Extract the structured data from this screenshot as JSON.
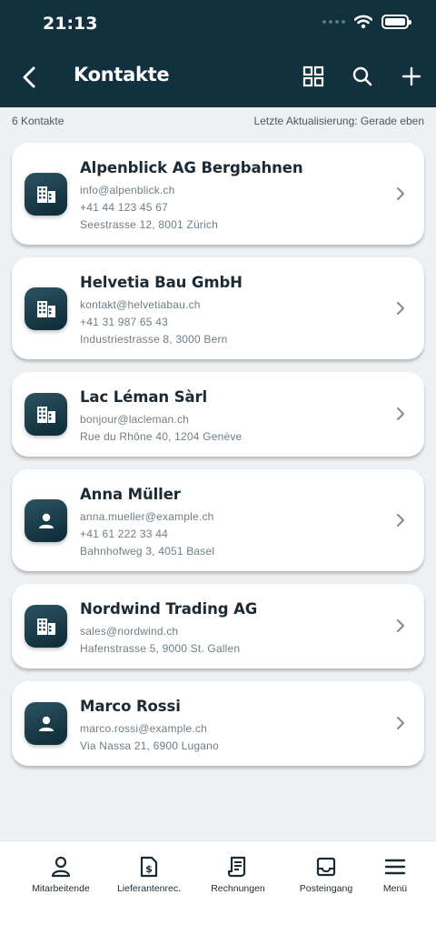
{
  "status_bar": {
    "time": "21:13"
  },
  "nav": {
    "title": "Kontakte",
    "icons": [
      "back-arrow-icon",
      "grid-view-icon",
      "search-icon",
      "plus-icon"
    ]
  },
  "list_meta": {
    "count_text": "6 Kontakte",
    "updated_text": "Letzte Aktualisierung: Gerade eben"
  },
  "contacts": [
    {
      "name": "Alpenblick AG Bergbahnen",
      "email": "info@alpenblick.ch",
      "phone": "+41 44 123 45 67",
      "address": "Seestrasse 12, 8001 Zürich",
      "icon": "building-icon"
    },
    {
      "name": "Helvetia Bau GmbH",
      "email": "kontakt@helvetiabau.ch",
      "phone": "+41 31 987 65 43",
      "address": "Industriestrasse 8, 3000 Bern",
      "icon": "building-icon"
    },
    {
      "name": "Lac Léman Sàrl",
      "email": "bonjour@lacleman.ch",
      "address": "Rue du Rhône 40, 1204 Genève",
      "icon": "building-icon"
    },
    {
      "name": "Anna Müller",
      "email": "anna.mueller@example.ch",
      "phone": "+41 61 222 33 44",
      "address": "Bahnhofweg 3, 4051 Basel",
      "icon": "person-icon"
    },
    {
      "name": "Nordwind Trading AG",
      "email": "sales@nordwind.ch",
      "address": "Hafenstrasse 5, 9000 St. Gallen",
      "icon": "building-icon"
    },
    {
      "name": "Marco Rossi",
      "email": "marco.rossi@example.ch",
      "address": "Via Nassa 21, 6900 Lugano",
      "icon": "person-icon"
    }
  ],
  "bottom_nav": [
    {
      "label": "Mitarbeitende",
      "icon": "person-outline-icon"
    },
    {
      "label": "Lieferantenrec.",
      "icon": "invoice-dollar-icon"
    },
    {
      "label": "Rechnungen",
      "icon": "receipt-icon"
    },
    {
      "label": "Posteingang",
      "icon": "inbox-icon"
    },
    {
      "label": "Menü",
      "icon": "hamburger-menu-icon"
    }
  ]
}
